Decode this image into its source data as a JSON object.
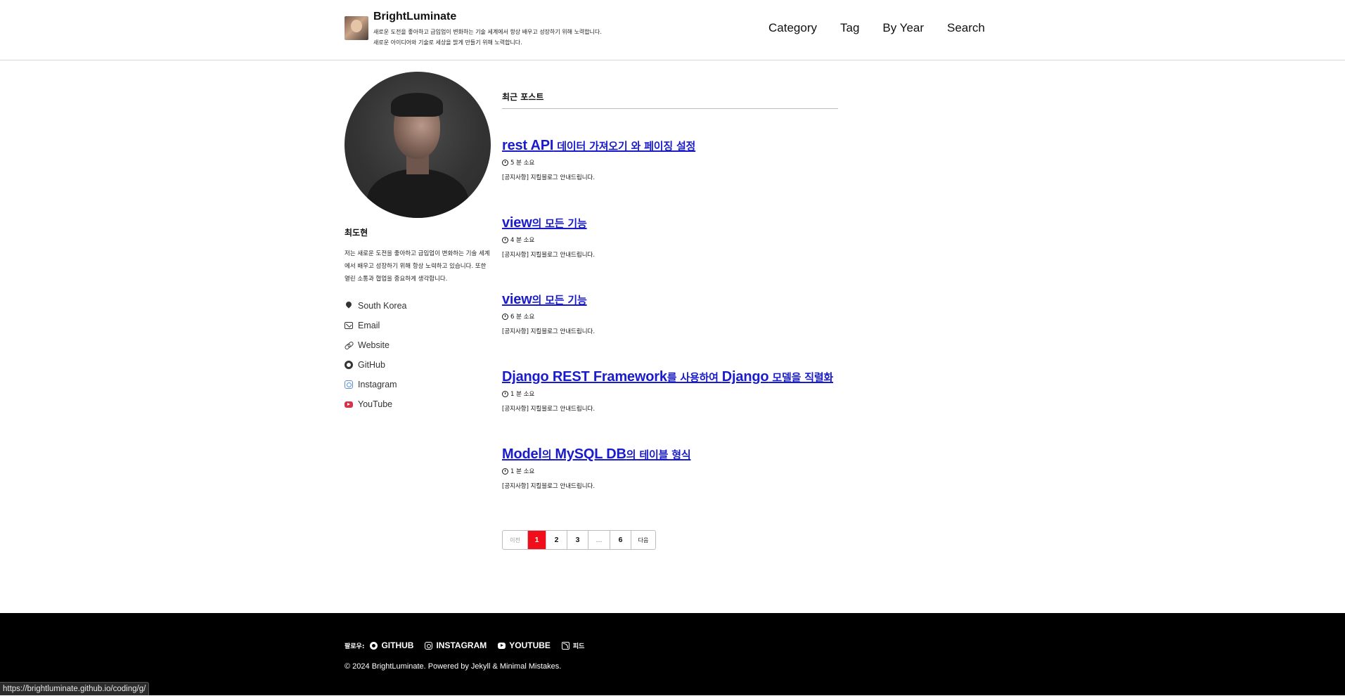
{
  "site": {
    "title": "BrightLuminate",
    "subtitle_line1": "새로운 도전을 좋아하고 급입업이 변화하는 기술 세계에서 항상 배우고 성장하기 위해 노력합니다.",
    "subtitle_line2": "새로운 아이디어와 기술로 세상을 밝게 만들기 위해 노력합니다."
  },
  "nav": {
    "items": [
      "Category",
      "Tag",
      "By Year",
      "Search"
    ]
  },
  "author": {
    "name": "최도현",
    "bio": "저는 새로운 도전을 좋아하고 급입업이 변화하는 기술 세계에서 배우고 성장하기 위해 항상 노력하고 있습니다. 또한 열린 소통과 협업을 중요하게 생각합니다.",
    "links": [
      {
        "label": "South Korea",
        "icon": "map-marker-icon"
      },
      {
        "label": "Email",
        "icon": "envelope-icon"
      },
      {
        "label": "Website",
        "icon": "link-icon"
      },
      {
        "label": "GitHub",
        "icon": "github-icon"
      },
      {
        "label": "Instagram",
        "icon": "instagram-icon"
      },
      {
        "label": "YouTube",
        "icon": "youtube-icon"
      }
    ]
  },
  "main": {
    "section_title": "최근 포스트",
    "posts": [
      {
        "title_en": "rest API",
        "title_ko": " 데이터 가져오기 와 페이징 설정",
        "read_time": "5 분 소요",
        "excerpt": "[공지사항] 지킬블로그 안내드립니다."
      },
      {
        "title_en": "view",
        "title_ko": "의 모든 기능",
        "read_time": "4 분 소요",
        "excerpt": "[공지사항] 지킬블로그 안내드립니다."
      },
      {
        "title_en": "view",
        "title_ko": "의 모든 기능",
        "read_time": "6 분 소요",
        "excerpt": "[공지사항] 지킬블로그 안내드립니다."
      },
      {
        "title_en": "Django REST Framework",
        "title_ko": "를 사용하여 ",
        "title_en2": "Django",
        "title_ko2": " 모델을 직렬화",
        "read_time": "1 분 소요",
        "excerpt": "[공지사항] 지킬블로그 안내드립니다."
      },
      {
        "title_en": "Model",
        "title_ko": "의 ",
        "title_en2": "MySQL DB",
        "title_ko2": "의 테이블 형식",
        "read_time": "1 분 소요",
        "excerpt": "[공지사항] 지킬블로그 안내드립니다."
      }
    ]
  },
  "pagination": {
    "prev": "이전",
    "pages": [
      "1",
      "2",
      "3",
      "...",
      "6"
    ],
    "active": "1",
    "next": "다음",
    "active_color": "#f20d1b"
  },
  "footer": {
    "follow_label": "팔로우:",
    "links": [
      {
        "label": "GITHUB",
        "icon": "github-icon"
      },
      {
        "label": "INSTAGRAM",
        "icon": "instagram-icon"
      },
      {
        "label": "YOUTUBE",
        "icon": "youtube-icon"
      },
      {
        "label": "피드",
        "icon": "rss-icon"
      }
    ],
    "copyright": "© 2024 BrightLuminate. Powered by Jekyll & Minimal Mistakes."
  },
  "status_bar": {
    "url": "https://brightluminate.github.io/coding/g/"
  },
  "colors": {
    "link": "#1a1ccc",
    "footer_bg": "#000000",
    "accent": "#f20d1b"
  }
}
